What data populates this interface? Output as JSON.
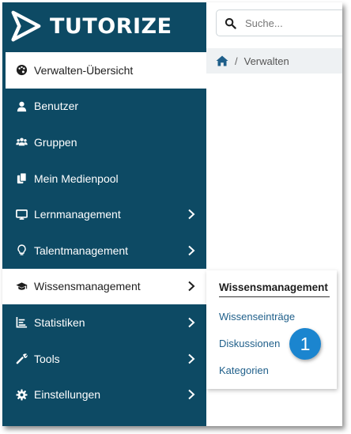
{
  "app": {
    "logo_text": "TUTORIZE"
  },
  "search": {
    "placeholder": "Suche..."
  },
  "breadcrumb": {
    "items": [
      "Verwalten"
    ]
  },
  "sidebar": {
    "items": [
      {
        "label": "Verwalten-Übersicht",
        "icon": "palette-icon",
        "state": "active"
      },
      {
        "label": "Benutzer",
        "icon": "user-icon"
      },
      {
        "label": "Gruppen",
        "icon": "users-icon"
      },
      {
        "label": "Mein Medienpool",
        "icon": "copy-icon"
      },
      {
        "label": "Lernmanagement",
        "icon": "monitor-icon",
        "has_submenu": true
      },
      {
        "label": "Talentmanagement",
        "icon": "lightbulb-icon",
        "has_submenu": true
      },
      {
        "label": "Wissensmanagement",
        "icon": "graduation-cap-icon",
        "has_submenu": true,
        "state": "open"
      },
      {
        "label": "Statistiken",
        "icon": "chart-icon",
        "has_submenu": true
      },
      {
        "label": "Tools",
        "icon": "wrench-icon",
        "has_submenu": true
      },
      {
        "label": "Einstellungen",
        "icon": "gear-icon",
        "has_submenu": true
      }
    ]
  },
  "submenu": {
    "title": "Wissensmanagement",
    "links": [
      "Wissenseinträge",
      "Diskussionen",
      "Kategorien"
    ]
  },
  "callout": {
    "number": "1"
  },
  "colors": {
    "sidebar": "#0d4a64",
    "link": "#1f5f8a",
    "callout": "#1b85cf",
    "breadcrumb_bg": "#eef1f3"
  }
}
